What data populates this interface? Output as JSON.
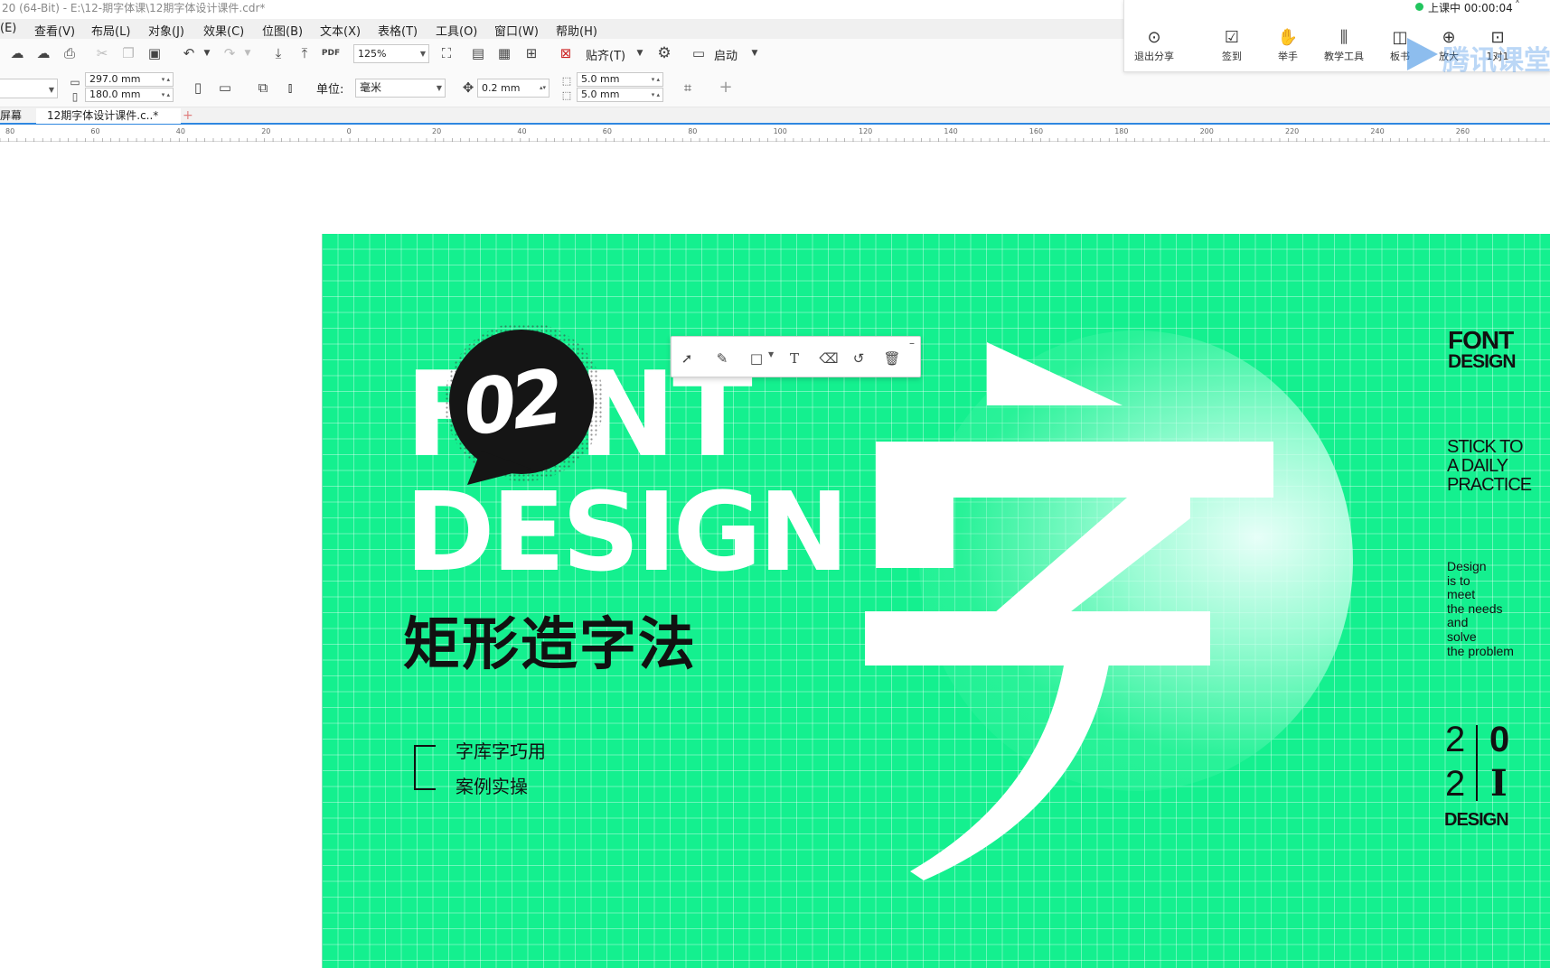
{
  "window": {
    "title": "20 (64-Bit) - E:\\12-期字体课\\12期字体设计课件.cdr*"
  },
  "menu": [
    "(E)",
    "查看(V)",
    "布局(L)",
    "对象(J)",
    "效果(C)",
    "位图(B)",
    "文本(X)",
    "表格(T)",
    "工具(O)",
    "窗口(W)",
    "帮助(H)"
  ],
  "toolbar": {
    "zoom": "125%",
    "snap_label": "贴齐(T)",
    "launch_label": "启动",
    "width": "297.0 mm",
    "height": "180.0 mm",
    "unit_label": "单位:",
    "unit_value": "毫米",
    "nudge": "0.2 mm",
    "dup_x": "5.0 mm",
    "dup_y": "5.0 mm"
  },
  "tabs": {
    "welcome": "屏幕",
    "document": "12期字体设计课件.c..*",
    "add": "+"
  },
  "ruler": {
    "labels": [
      "80",
      "60",
      "40",
      "20",
      "0",
      "20",
      "40",
      "60",
      "80",
      "100",
      "120",
      "140",
      "160",
      "180",
      "200",
      "220",
      "240",
      "260"
    ]
  },
  "class_panel": {
    "status": "上课中 00:00:04",
    "buttons": [
      {
        "label": "退出分享",
        "icon": "exit-share-icon"
      },
      {
        "label": "签到",
        "icon": "checkin-icon"
      },
      {
        "label": "举手",
        "icon": "raise-hand-icon"
      },
      {
        "label": "教学工具",
        "icon": "teaching-tools-icon"
      },
      {
        "label": "板书",
        "icon": "board-icon"
      },
      {
        "label": "放大",
        "icon": "zoom-icon"
      },
      {
        "label": "1对1",
        "icon": "one-on-one-icon"
      }
    ],
    "watermark": "腾讯课堂"
  },
  "artwork": {
    "badge_number": "02",
    "headline_line1": "FONT",
    "headline_line2": "DESIGN",
    "subtitle_cn": "矩形造字法",
    "list_items": [
      "字库字巧用",
      "案例实操"
    ],
    "right_title_1": "FONT",
    "right_title_2": "DESIGN",
    "tagline": [
      "STICK TO",
      "A DAILY",
      "PRACTICE"
    ],
    "description": [
      "Design",
      "is to",
      "meet",
      "the needs",
      "and",
      "solve",
      "the problem"
    ],
    "year_digits": [
      "2",
      "0",
      "2",
      "I"
    ],
    "year_label": "DESIGN",
    "big_character": "字"
  },
  "colors": {
    "artboard_bg": "#14f08f",
    "accent_blue": "#2f87e0",
    "status_green": "#22c55e"
  }
}
